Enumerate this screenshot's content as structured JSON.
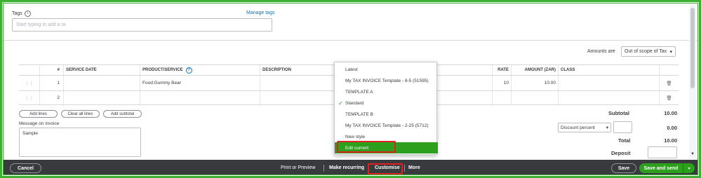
{
  "tags": {
    "label": "Tags",
    "manage": "Manage tags",
    "placeholder": "Start typing to add a ta"
  },
  "amounts": {
    "label": "Amounts are",
    "value": "Out of scope of Tax"
  },
  "table": {
    "headers": {
      "num": "#",
      "service_date": "SERVICE DATE",
      "product": "PRODUCT/SERVICE",
      "description": "DESCRIPTION",
      "rate": "RATE",
      "amount": "AMOUNT (ZAR)",
      "class": "CLASS"
    },
    "rows": [
      {
        "num": "1",
        "product": "Food:Gummy Bear",
        "rate": "10",
        "amount": "10.00"
      },
      {
        "num": "2",
        "product": "",
        "rate": "",
        "amount": ""
      }
    ]
  },
  "buttons": {
    "add_lines": "Add lines",
    "clear_lines": "Clear all lines",
    "add_subtotal": "Add subtotal"
  },
  "message": {
    "label": "Message on invoice",
    "value": "Sample"
  },
  "totals": {
    "subtotal_label": "Subtotal",
    "subtotal": "10.00",
    "discount_type": "Discount percent",
    "discount": "0.00",
    "total_label": "Total",
    "total": "10.00",
    "deposit_label": "Deposit"
  },
  "dropdown": {
    "items": [
      "Latest",
      "My TAX INVOICE Template - 8-5 (51595)",
      "TEMPLATE A",
      "Standard",
      "TEMPLATE B",
      "My TAX INVOICE Template - 2-25 (5712)",
      "New style",
      "Edit current"
    ],
    "checked": "Standard"
  },
  "footer": {
    "cancel": "Cancel",
    "print_preview": "Print or Preview",
    "make_recurring": "Make recurring",
    "customise": "Customise",
    "more": "More",
    "save": "Save",
    "save_send": "Save and send"
  },
  "colors": {
    "accent": "#2ca01c",
    "highlight": "#e02020",
    "footer": "#393a3d",
    "frame": "#3cb030"
  }
}
